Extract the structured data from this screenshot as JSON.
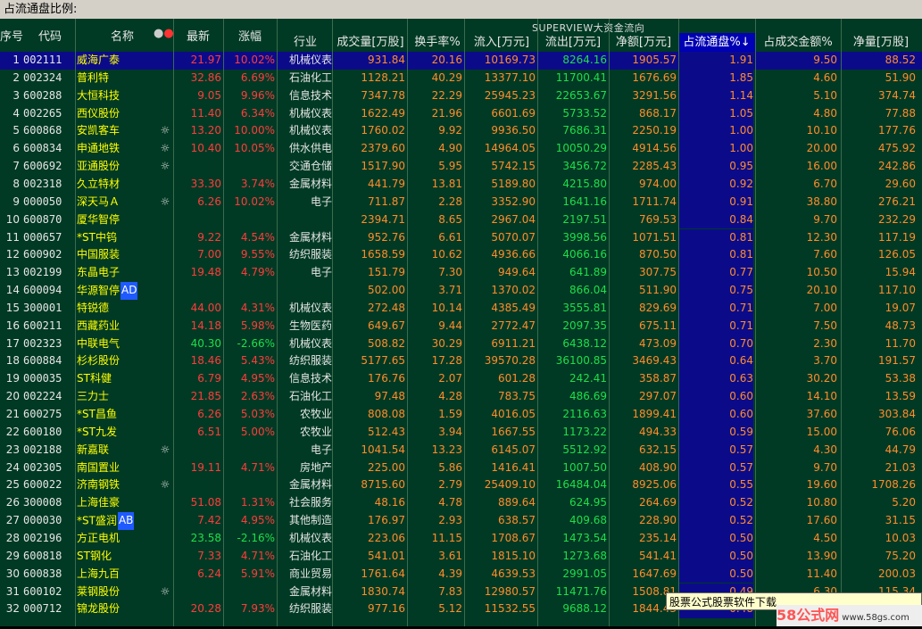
{
  "window": {
    "title": "占流通盘比例:"
  },
  "header": {
    "super_label": "SUPERVIEW大资金流向",
    "idx": "序号",
    "code": "代码",
    "name": "名称",
    "latest": "最新",
    "change": "涨幅",
    "industry": "行业",
    "volume": "成交量[万股]",
    "turnover": "换手率%",
    "inflow": "流入[万元]",
    "outflow": "流出[万元]",
    "net": "净额[万元]",
    "ratio": "占流通盘%",
    "amt_pct": "占成交金额%",
    "net_shares": "净量[万股]"
  },
  "rows": [
    [
      "1",
      "002111",
      "威海广泰",
      "",
      "21.97",
      "10.02%",
      "机械仪表",
      "931.84",
      "20.16",
      "10169.73",
      "8264.16",
      "1905.57",
      "1.91",
      "9.50",
      "88.52"
    ],
    [
      "2",
      "002324",
      "普利特",
      "",
      "32.86",
      "6.69%",
      "石油化工",
      "1128.21",
      "40.29",
      "13377.10",
      "11700.41",
      "1676.69",
      "1.85",
      "4.60",
      "51.90"
    ],
    [
      "3",
      "600288",
      "大恒科技",
      "",
      "9.05",
      "9.96%",
      "信息技术",
      "7347.78",
      "22.29",
      "25945.23",
      "22653.67",
      "3291.56",
      "1.14",
      "5.10",
      "374.74"
    ],
    [
      "4",
      "002265",
      "西仪股份",
      "",
      "11.40",
      "6.34%",
      "机械仪表",
      "1622.49",
      "21.96",
      "6601.69",
      "5733.52",
      "868.17",
      "1.05",
      "4.80",
      "77.88"
    ],
    [
      "5",
      "600868",
      "安凯客车",
      "☼",
      "13.20",
      "10.00%",
      "机械仪表",
      "1760.02",
      "9.92",
      "9936.50",
      "7686.31",
      "2250.19",
      "1.00",
      "10.10",
      "177.76"
    ],
    [
      "6",
      "600834",
      "申通地铁",
      "☼",
      "10.40",
      "10.05%",
      "供水供电",
      "2379.60",
      "4.90",
      "14964.05",
      "10050.29",
      "4914.56",
      "1.00",
      "20.00",
      "475.92"
    ],
    [
      "7",
      "600692",
      "亚通股份",
      "☼",
      "",
      "",
      "交通仓储",
      "1517.90",
      "5.95",
      "5742.15",
      "3456.72",
      "2285.43",
      "0.95",
      "16.00",
      "242.86"
    ],
    [
      "8",
      "002318",
      "久立特材",
      "",
      "33.30",
      "3.74%",
      "金属材料",
      "441.79",
      "13.81",
      "5189.80",
      "4215.80",
      "974.00",
      "0.92",
      "6.70",
      "29.60"
    ],
    [
      "9",
      "000050",
      "深天马Ａ",
      "☼",
      "6.26",
      "10.02%",
      "电子",
      "711.87",
      "2.28",
      "3352.90",
      "1641.16",
      "1711.74",
      "0.91",
      "38.80",
      "276.21"
    ],
    [
      "10",
      "600870",
      "厦华智停",
      "",
      "",
      "",
      "",
      "2394.71",
      "8.65",
      "2967.04",
      "2197.51",
      "769.53",
      "0.84",
      "9.70",
      "232.29"
    ],
    [
      "11",
      "000657",
      "*ST中钨",
      "",
      "9.22",
      "4.54%",
      "金属材料",
      "952.76",
      "6.61",
      "5070.07",
      "3998.56",
      "1071.51",
      "0.81",
      "12.30",
      "117.19"
    ],
    [
      "12",
      "600902",
      "中国服装",
      "",
      "7.00",
      "9.55%",
      "纺织服装",
      "1658.59",
      "10.62",
      "4936.66",
      "4066.16",
      "870.50",
      "0.81",
      "7.60",
      "126.05"
    ],
    [
      "13",
      "002199",
      "东晶电子",
      "",
      "19.48",
      "4.79%",
      "电子",
      "151.79",
      "7.30",
      "949.64",
      "641.89",
      "307.75",
      "0.77",
      "10.50",
      "15.94"
    ],
    [
      "14",
      "600094",
      "华源智停AD",
      "",
      "",
      "",
      "",
      "502.00",
      "3.71",
      "1370.02",
      "866.04",
      "511.90",
      "0.75",
      "20.10",
      "117.10"
    ],
    [
      "15",
      "300001",
      "特锐德",
      "",
      "44.00",
      "4.31%",
      "机械仪表",
      "272.48",
      "10.14",
      "4385.49",
      "3555.81",
      "829.69",
      "0.71",
      "7.00",
      "19.07"
    ],
    [
      "16",
      "600211",
      "西藏药业",
      "",
      "14.18",
      "5.98%",
      "生物医药",
      "649.67",
      "9.44",
      "2772.47",
      "2097.35",
      "675.11",
      "0.71",
      "7.50",
      "48.73"
    ],
    [
      "17",
      "002323",
      "中联电气",
      "",
      "40.30",
      "-2.66%",
      "机械仪表",
      "508.82",
      "30.29",
      "6911.21",
      "6438.12",
      "473.09",
      "0.70",
      "2.30",
      "11.70"
    ],
    [
      "18",
      "600884",
      "杉杉股份",
      "",
      "18.46",
      "5.43%",
      "纺织服装",
      "5177.65",
      "17.28",
      "39570.28",
      "36100.85",
      "3469.43",
      "0.64",
      "3.70",
      "191.57"
    ],
    [
      "19",
      "000035",
      "ST科健",
      "",
      "6.79",
      "4.95%",
      "信息技术",
      "176.76",
      "2.07",
      "601.28",
      "242.41",
      "358.87",
      "0.63",
      "30.20",
      "53.38"
    ],
    [
      "20",
      "002224",
      "三力士",
      "",
      "21.85",
      "2.63%",
      "石油化工",
      "97.48",
      "4.28",
      "783.75",
      "486.69",
      "297.07",
      "0.60",
      "14.10",
      "13.59"
    ],
    [
      "21",
      "600275",
      "*ST昌鱼",
      "",
      "6.26",
      "5.03%",
      "农牧业",
      "808.08",
      "1.59",
      "4016.05",
      "2116.63",
      "1899.41",
      "0.60",
      "37.60",
      "303.84"
    ],
    [
      "22",
      "600180",
      "*ST九发",
      "",
      "6.51",
      "5.00%",
      "农牧业",
      "512.43",
      "3.94",
      "1667.55",
      "1173.22",
      "494.33",
      "0.59",
      "15.00",
      "76.06"
    ],
    [
      "23",
      "002188",
      "新嘉联",
      "☼",
      "",
      "",
      "电子",
      "1041.54",
      "13.23",
      "6145.07",
      "5512.92",
      "632.15",
      "0.57",
      "4.30",
      "44.79"
    ],
    [
      "24",
      "002305",
      "南国置业",
      "",
      "19.11",
      "4.71%",
      "房地产",
      "225.00",
      "5.86",
      "1416.41",
      "1007.50",
      "408.90",
      "0.57",
      "9.70",
      "21.03"
    ],
    [
      "25",
      "600022",
      "济南钢铁",
      "☼",
      "",
      "",
      "金属材料",
      "8715.60",
      "2.79",
      "25409.10",
      "16484.04",
      "8925.06",
      "0.55",
      "19.60",
      "1708.26"
    ],
    [
      "26",
      "300008",
      "上海佳豪",
      "",
      "51.08",
      "1.31%",
      "社会服务",
      "48.16",
      "4.78",
      "889.64",
      "624.95",
      "264.69",
      "0.52",
      "10.80",
      "5.20"
    ],
    [
      "27",
      "000030",
      "*ST盛润AB",
      "",
      "7.42",
      "4.95%",
      "其他制造",
      "176.97",
      "2.93",
      "638.57",
      "409.68",
      "228.90",
      "0.52",
      "17.60",
      "31.15"
    ],
    [
      "28",
      "002196",
      "方正电机",
      "",
      "23.58",
      "-2.16%",
      "机械仪表",
      "223.06",
      "11.15",
      "1708.67",
      "1473.54",
      "235.14",
      "0.50",
      "4.50",
      "10.03"
    ],
    [
      "29",
      "600818",
      "ST钢化",
      "",
      "7.33",
      "4.71%",
      "石油化工",
      "541.01",
      "3.61",
      "1815.10",
      "1273.68",
      "541.41",
      "0.50",
      "13.90",
      "75.20"
    ],
    [
      "30",
      "600838",
      "上海九百",
      "",
      "6.24",
      "5.91%",
      "商业贸易",
      "1761.64",
      "4.39",
      "4639.53",
      "2991.05",
      "1647.69",
      "0.50",
      "11.40",
      "200.03"
    ],
    [
      "31",
      "600102",
      "莱钢股份",
      "☼",
      "",
      "",
      "金属材料",
      "1830.74",
      "7.83",
      "12980.57",
      "11471.76",
      "1508.81",
      "0.49",
      "6.30",
      "115.34"
    ],
    [
      "32",
      "000712",
      "锦龙股份",
      "",
      "20.28",
      "7.93%",
      "纺织服装",
      "977.16",
      "5.12",
      "11532.55",
      "9688.12",
      "1844.43",
      "0.48",
      "8.80",
      "90.87"
    ]
  ],
  "popup": {
    "text": "股票公式股票软件下载"
  },
  "watermark": {
    "brand": "58公式网",
    "url": "www.58gs.com"
  }
}
